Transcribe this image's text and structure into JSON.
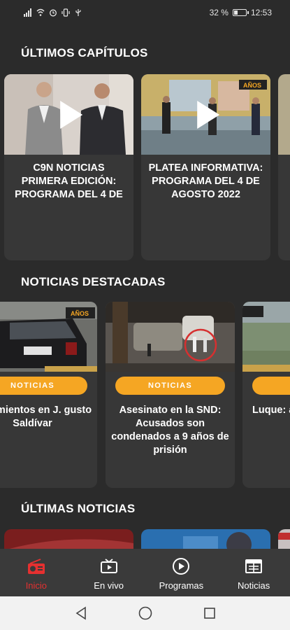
{
  "status": {
    "battery_percent_text": "32 %",
    "battery_level": 0.32,
    "time": "12:53"
  },
  "sections": {
    "episodes_title": "ÚLTIMOS CAPÍTULOS",
    "featured_title": "NOTICIAS DESTACADAS",
    "latest_title": "ÚLTIMAS NOTICIAS"
  },
  "episodes": [
    {
      "title": "C9N NOTICIAS PRIMERA EDICIÓN: PROGRAMA DEL 4 DE"
    },
    {
      "title": "PLATEA INFORMATIVA: PROGRAMA DEL 4 DE AGOSTO 2022"
    }
  ],
  "featured": [
    {
      "category": "NOTICIAS",
      "title": "llanamientos en J. gusto Saldívar"
    },
    {
      "category": "NOTICIAS",
      "title": "Asesinato en la SND: Acusados son condenados a 9 años de prisión"
    },
    {
      "category": "N",
      "title": "Luque: asaltaro"
    }
  ],
  "thumb_overlay": {
    "logo_text": "AÑOS"
  },
  "nav": {
    "inicio": "Inicio",
    "en_vivo": "En vivo",
    "programas": "Programas",
    "noticias": "Noticias"
  },
  "colors": {
    "accent": "#f5a623",
    "active": "#e53030",
    "background": "#2b2b2b",
    "card": "#373737"
  },
  "icons": {
    "signal": "signal-icon",
    "wifi": "wifi-icon",
    "alarm": "alarm-icon",
    "vibrate": "vibrate-icon",
    "usb": "usb-icon",
    "battery": "battery-icon",
    "radio": "radio-icon",
    "tv": "tv-icon",
    "play": "play-circle-icon",
    "news": "newspaper-icon"
  }
}
